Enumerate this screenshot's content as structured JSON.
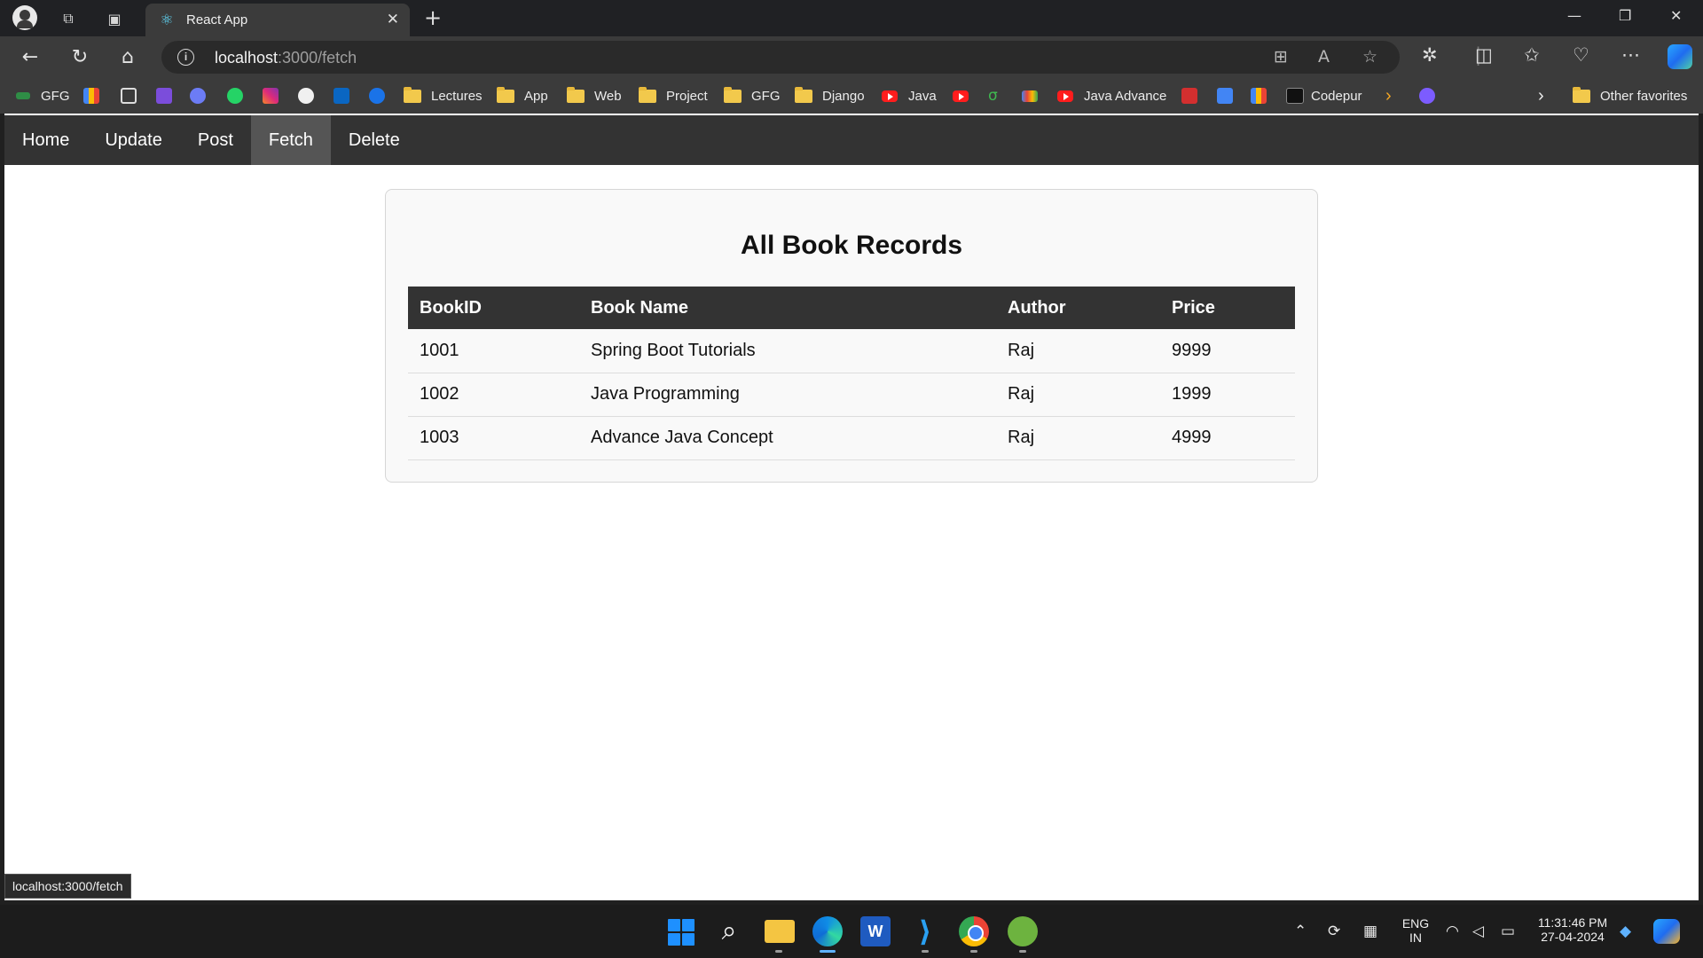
{
  "browser": {
    "tab_title": "React App",
    "url_host": "localhost",
    "url_path": ":3000/fetch"
  },
  "favorites": {
    "items": [
      {
        "label": "GFG",
        "icon": "gfg-icon"
      },
      {
        "label": "Lectures",
        "icon": "folder-icon"
      },
      {
        "label": "App",
        "icon": "folder-icon"
      },
      {
        "label": "Web",
        "icon": "folder-icon"
      },
      {
        "label": "Project",
        "icon": "folder-icon"
      },
      {
        "label": "GFG",
        "icon": "folder-icon"
      },
      {
        "label": "Django",
        "icon": "folder-icon"
      },
      {
        "label": "Java",
        "icon": "youtube-icon"
      },
      {
        "label": "Java Advance",
        "icon": "youtube-icon"
      },
      {
        "label": "Codepur",
        "icon": "codepen-icon"
      }
    ],
    "other": "Other favorites"
  },
  "app": {
    "nav": [
      "Home",
      "Update",
      "Post",
      "Fetch",
      "Delete"
    ],
    "active_nav": "Fetch",
    "heading": "All Book Records",
    "table": {
      "headers": [
        "BookID",
        "Book Name",
        "Author",
        "Price"
      ],
      "rows": [
        [
          "1001",
          "Spring Boot Tutorials",
          "Raj",
          "9999"
        ],
        [
          "1002",
          "Java Programming",
          "Raj",
          "1999"
        ],
        [
          "1003",
          "Advance Java Concept",
          "Raj",
          "4999"
        ]
      ]
    }
  },
  "status_tooltip": "localhost:3000/fetch",
  "taskbar": {
    "lang_top": "ENG",
    "lang_bottom": "IN",
    "time": "11:31:46 PM",
    "date": "27-04-2024"
  },
  "colors": {
    "nav_bg": "#333333",
    "nav_active": "#555555",
    "table_header_bg": "#333333",
    "card_bg": "#f9f9f9"
  }
}
